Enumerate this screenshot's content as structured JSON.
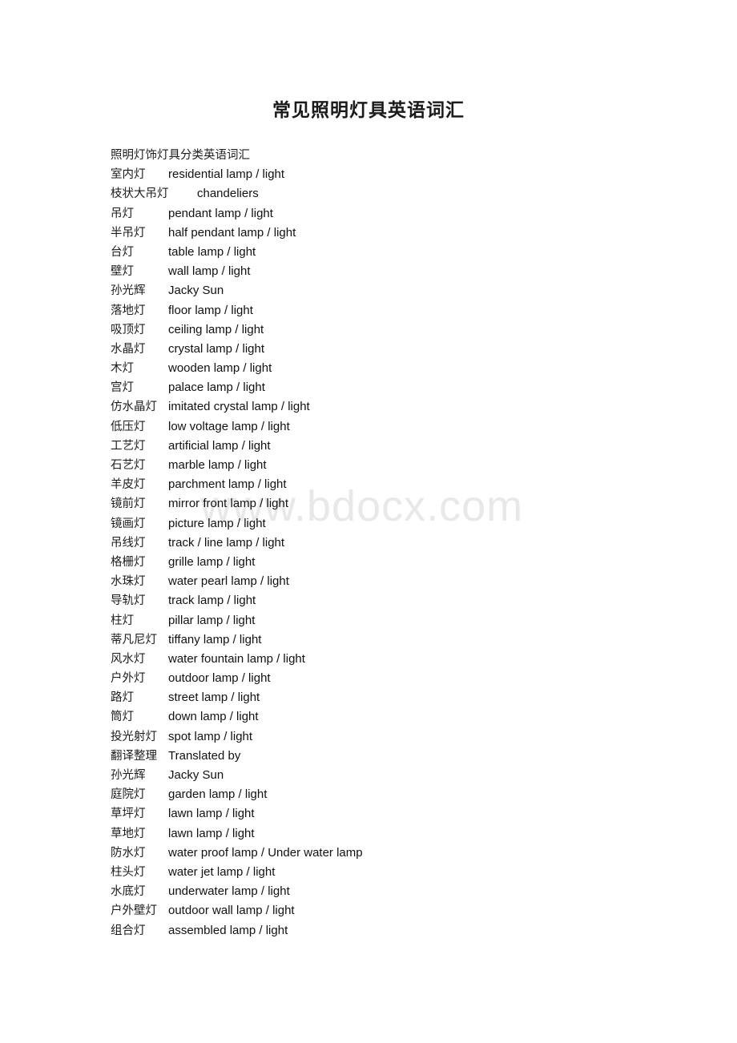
{
  "document": {
    "title": "常见照明灯具英语词汇",
    "heading": "照明灯饰灯具分类英语词汇",
    "watermark": "www.bdocx.com",
    "entries": [
      {
        "term": "室内灯",
        "gloss": "residential lamp / light"
      },
      {
        "term": "枝状大吊灯",
        "gloss": "chandeliers"
      },
      {
        "term": "吊灯",
        "gloss": "pendant lamp / light"
      },
      {
        "term": "半吊灯",
        "gloss": "half pendant lamp / light"
      },
      {
        "term": "台灯",
        "gloss": "table lamp / light"
      },
      {
        "term": "壁灯",
        "gloss": "wall lamp / light"
      },
      {
        "term": "孙光辉",
        "gloss": "Jacky Sun"
      },
      {
        "term": "落地灯",
        "gloss": "floor lamp / light"
      },
      {
        "term": "吸顶灯",
        "gloss": "ceiling lamp / light"
      },
      {
        "term": "水晶灯",
        "gloss": "crystal lamp / light"
      },
      {
        "term": "木灯",
        "gloss": "wooden lamp / light"
      },
      {
        "term": "宫灯",
        "gloss": "palace lamp / light"
      },
      {
        "term": "仿水晶灯",
        "gloss": "imitated crystal lamp / light"
      },
      {
        "term": "低压灯",
        "gloss": "low voltage lamp / light"
      },
      {
        "term": "工艺灯",
        "gloss": "artificial lamp / light"
      },
      {
        "term": "石艺灯",
        "gloss": "marble lamp / light"
      },
      {
        "term": "羊皮灯",
        "gloss": "parchment lamp / light"
      },
      {
        "term": "镜前灯",
        "gloss": "mirror front lamp / light"
      },
      {
        "term": "镜画灯",
        "gloss": "picture lamp / light"
      },
      {
        "term": "吊线灯",
        "gloss": "track / line lamp / light"
      },
      {
        "term": "格栅灯",
        "gloss": "grille lamp / light"
      },
      {
        "term": "水珠灯",
        "gloss": "water pearl lamp / light"
      },
      {
        "term": "导轨灯",
        "gloss": "track lamp / light"
      },
      {
        "term": "柱灯",
        "gloss": "pillar lamp / light"
      },
      {
        "term": "蒂凡尼灯",
        "gloss": "tiffany lamp / light"
      },
      {
        "term": "风水灯",
        "gloss": "water fountain lamp / light"
      },
      {
        "term": "户外灯",
        "gloss": "outdoor lamp / light"
      },
      {
        "term": "路灯",
        "gloss": "street lamp / light"
      },
      {
        "term": "筒灯",
        "gloss": "down lamp / light"
      },
      {
        "term": "投光射灯",
        "gloss": "spot lamp / light"
      },
      {
        "term": "翻译整理",
        "gloss": "Translated by"
      },
      {
        "term": "孙光辉",
        "gloss": "Jacky Sun"
      },
      {
        "term": "庭院灯",
        "gloss": "garden lamp / light"
      },
      {
        "term": "草坪灯",
        "gloss": "lawn lamp / light"
      },
      {
        "term": "草地灯",
        "gloss": "lawn lamp / light"
      },
      {
        "term": "防水灯",
        "gloss": "water proof lamp / Under water lamp"
      },
      {
        "term": "柱头灯",
        "gloss": "water jet lamp / light"
      },
      {
        "term": "水底灯",
        "gloss": "underwater lamp / light"
      },
      {
        "term": "户外壁灯",
        "gloss": "outdoor wall lamp / light"
      },
      {
        "term": "组合灯",
        "gloss": "assembled lamp / light"
      }
    ]
  }
}
